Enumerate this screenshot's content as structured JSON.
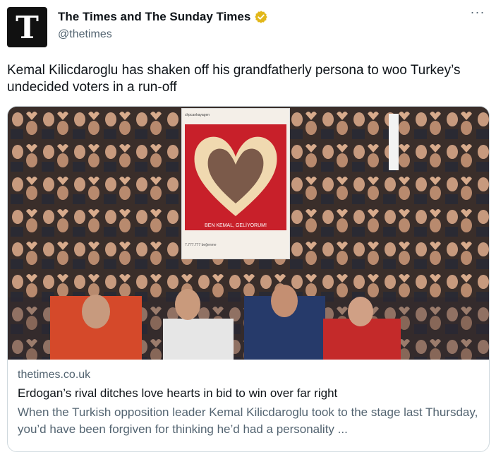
{
  "account": {
    "display_name": "The Times and The Sunday Times",
    "handle": "@thetimes",
    "avatar_letter": "T",
    "verified_color": "#e2b719"
  },
  "menu": {
    "more_label": "···"
  },
  "tweet": {
    "text": "Kemal Kilicdaroglu has shaken off his grandfatherly persona to woo Turkey’s undecided voters in a run-off"
  },
  "card": {
    "image_icon": "crowd-photo",
    "sign": {
      "top_text": "chpcankayagen",
      "banner_text": "BEN KEMAL, GELİYORUM!",
      "likes_text": "7.777.777 beğenme"
    },
    "domain": "thetimes.co.uk",
    "title": "Erdogan’s rival ditches love hearts in bid to win over far right",
    "description": "When the Turkish opposition leader Kemal Kilicdaroglu took to the stage last Thursday, you’d have been forgiven for thinking he’d had a personality ..."
  }
}
